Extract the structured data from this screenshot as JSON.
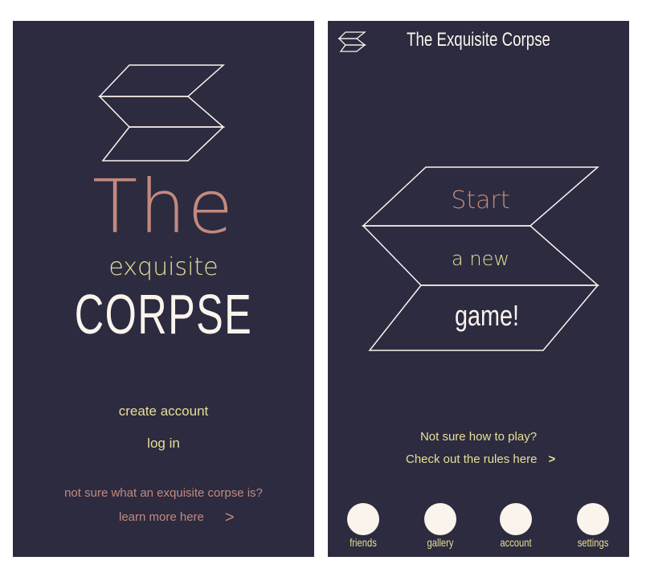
{
  "login": {
    "title_the": "The",
    "title_exquisite": "exquisite",
    "title_corpse": "CORPSE",
    "create_account": "create account",
    "log_in": "log in",
    "not_sure": "not sure what an exquisite corpse is?",
    "learn_more": "learn more here",
    "learn_more_chevron": ">"
  },
  "home": {
    "app_title": "The Exquisite Corpse",
    "start_game": {
      "line1": "Start",
      "line2": "a new",
      "line3": "game!"
    },
    "rules_question": "Not sure how to play?",
    "rules_link": "Check out the rules here",
    "rules_chevron": ">",
    "nav": [
      {
        "label": "friends"
      },
      {
        "label": "gallery"
      },
      {
        "label": "account"
      },
      {
        "label": "settings"
      }
    ]
  },
  "colors": {
    "background": "#2c2b40",
    "rose": "#c38a7e",
    "gold": "#e9df95",
    "cream": "#fbf4ec"
  }
}
